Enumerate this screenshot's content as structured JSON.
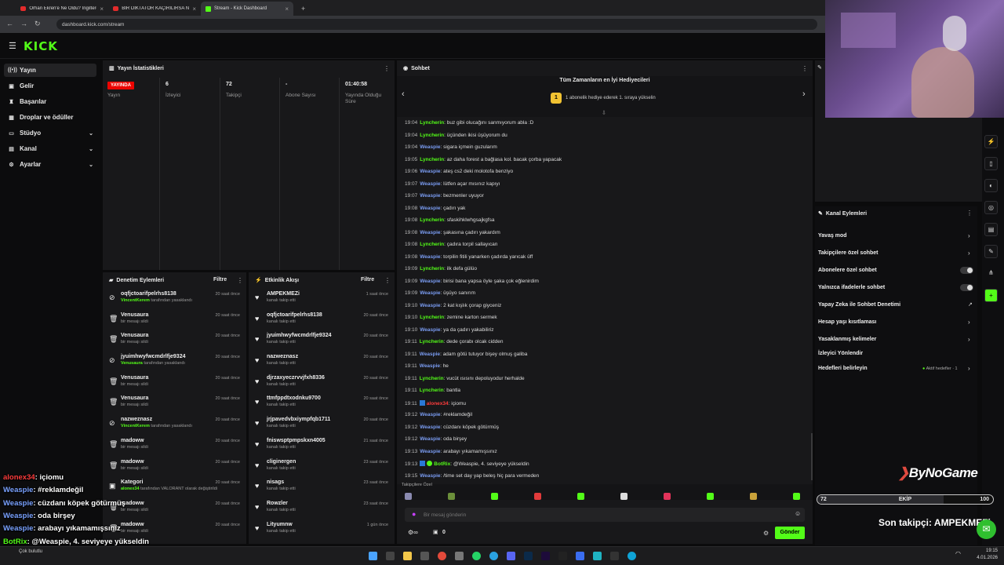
{
  "browser": {
    "tabs": [
      {
        "label": "Orhan Ekren'e Ne Oldu? İngiltere...",
        "icon": "youtube-icon"
      },
      {
        "label": "BİR DİKTATÖR KAÇIRILIRSA NE...",
        "icon": "youtube-icon"
      },
      {
        "label": "Stream - Kick Dashboard",
        "icon": "kick-icon"
      }
    ],
    "url": "dashboard.kick.com/stream"
  },
  "brand": {
    "logo": "KICK",
    "accent": "#53fc18"
  },
  "sidebar": {
    "items": [
      {
        "label": "Yayın",
        "icon": "broadcast-icon"
      },
      {
        "label": "Gelir",
        "icon": "income-icon"
      },
      {
        "label": "Başarılar",
        "icon": "trophy-icon"
      },
      {
        "label": "Droplar ve ödüller",
        "icon": "gift-icon"
      },
      {
        "label": "Stüdyo",
        "icon": "studio-icon"
      },
      {
        "label": "Kanal",
        "icon": "channel-icon"
      },
      {
        "label": "Ayarlar",
        "icon": "gear-icon"
      }
    ]
  },
  "stats": {
    "title": "Yayın İstatistikleri",
    "live_badge": "YAYINDA",
    "items": [
      {
        "value": "",
        "label": "Yayın"
      },
      {
        "value": "6",
        "label": "İzleyici"
      },
      {
        "value": "72",
        "label": "Takipçi"
      },
      {
        "value": "-",
        "label": "Abone Sayısı"
      },
      {
        "value": "01:40:58",
        "label": "Yayında Olduğu Süre"
      }
    ]
  },
  "moderation": {
    "title": "Denetim Eylemleri",
    "filter": "Filtre",
    "rows": [
      {
        "icon": "ban-icon",
        "name": "oqfjctoarifpelrhs8138",
        "actor": "VincentKerem",
        "detail": "tarafından yasaklandı",
        "time": "20 saat önce"
      },
      {
        "icon": "trash-icon",
        "name": "Venusaura",
        "actor": "",
        "detail": "bir mesajı sildi",
        "time": "20 saat önce"
      },
      {
        "icon": "trash-icon",
        "name": "Venusaura",
        "actor": "",
        "detail": "bir mesajı sildi",
        "time": "20 saat önce"
      },
      {
        "icon": "ban-icon",
        "name": "jyuimhwyfwcmdrlfje9324",
        "actor": "Venusaura",
        "detail": "tarafından yasaklandı",
        "time": "20 saat önce"
      },
      {
        "icon": "trash-icon",
        "name": "Venusaura",
        "actor": "",
        "detail": "bir mesajı sildi",
        "time": "20 saat önce"
      },
      {
        "icon": "trash-icon",
        "name": "Venusaura",
        "actor": "",
        "detail": "bir mesajı sildi",
        "time": "20 saat önce"
      },
      {
        "icon": "ban-icon",
        "name": "nazweznasz",
        "actor": "VincentKerem",
        "detail": "tarafından yasaklandı",
        "time": "20 saat önce"
      },
      {
        "icon": "trash-icon",
        "name": "madoww",
        "actor": "",
        "detail": "bir mesajı sildi",
        "time": "20 saat önce"
      },
      {
        "icon": "trash-icon",
        "name": "madoww",
        "actor": "",
        "detail": "bir mesajı sildi",
        "time": "20 saat önce"
      },
      {
        "icon": "category-icon",
        "name": "Kategori",
        "actor": "alonex34",
        "detail": "tarafından VALORANT olarak değiştirildi",
        "time": "20 saat önce"
      },
      {
        "icon": "trash-icon",
        "name": "madoww",
        "actor": "",
        "detail": "bir mesajı sildi",
        "time": "20 saat önce"
      },
      {
        "icon": "trash-icon",
        "name": "madoww",
        "actor": "",
        "detail": "bir mesajı sildi",
        "time": "20 saat önce"
      }
    ]
  },
  "activity": {
    "title": "Etkinlik Akışı",
    "filter": "Filtre",
    "rows": [
      {
        "name": "AMPEKMEZi",
        "detail": "kanalı takip etti",
        "time": "1 saat önce"
      },
      {
        "name": "oqfjctoarifpelrhs8138",
        "detail": "kanalı takip etti",
        "time": "20 saat önce"
      },
      {
        "name": "jyuimhwyfwcmdrlfje9324",
        "detail": "kanalı takip etti",
        "time": "20 saat önce"
      },
      {
        "name": "nazweznasz",
        "detail": "kanalı takip etti",
        "time": "20 saat önce"
      },
      {
        "name": "djrzaxyeczrvvjfxh8336",
        "detail": "kanalı takip etti",
        "time": "20 saat önce"
      },
      {
        "name": "ttmfppdtxodnku9700",
        "detail": "kanalı takip etti",
        "time": "20 saat önce"
      },
      {
        "name": "jrjpavedvbxiympfqb1711",
        "detail": "kanalı takip etti",
        "time": "20 saat önce"
      },
      {
        "name": "fniswsptpmpskxn4005",
        "detail": "kanalı takip etti",
        "time": "21 saat önce"
      },
      {
        "name": "cliginergen",
        "detail": "kanalı takip etti",
        "time": "23 saat önce"
      },
      {
        "name": "nisags",
        "detail": "kanalı takip etti",
        "time": "23 saat önce"
      },
      {
        "name": "Rowzler",
        "detail": "kanalı takip etti",
        "time": "23 saat önce"
      },
      {
        "name": "Lityumnw",
        "detail": "kanalı takip etti",
        "time": "1 gün önce"
      }
    ]
  },
  "chat": {
    "title": "Sohbet",
    "gifters_title": "Tüm Zamanların en İyi Hediyecileri",
    "gifters_rank": "1",
    "gifters_hint": "1 abonelik hediye ederek 1. sıraya yükselin",
    "messages": [
      {
        "time": "19:04",
        "user": "Lyncherin",
        "color": "green",
        "text": "buz gibi olucağını sanmıyorum abla :D"
      },
      {
        "time": "19:04",
        "user": "Lyncherin",
        "color": "green",
        "text": "üçünden ikisi üşüyorum du"
      },
      {
        "time": "19:04",
        "user": "Weaspie",
        "color": "blue",
        "text": "sigara içmein guzularım"
      },
      {
        "time": "19:05",
        "user": "Lyncherin",
        "color": "green",
        "text": "az daha forest a bağlasa kol. bacak çorba yapacak"
      },
      {
        "time": "19:06",
        "user": "Weaspie",
        "color": "blue",
        "text": "ateş cs2 deki molotofa benziyo"
      },
      {
        "time": "19:07",
        "user": "Weaspie",
        "color": "blue",
        "text": "lütfen açar mısınız kapıyı"
      },
      {
        "time": "19:07",
        "user": "Weaspie",
        "color": "blue",
        "text": "bezmenler uyuyor"
      },
      {
        "time": "19:08",
        "user": "Weaspie",
        "color": "blue",
        "text": "çadırı yak"
      },
      {
        "time": "19:08",
        "user": "Lyncherin",
        "color": "green",
        "text": "sfaskihklwhgsajkgfsa"
      },
      {
        "time": "19:08",
        "user": "Weaspie",
        "color": "blue",
        "text": "şakasına çadırı yakardım"
      },
      {
        "time": "19:08",
        "user": "Lyncherin",
        "color": "green",
        "text": "çadıra torpil sallayıcan"
      },
      {
        "time": "19:08",
        "user": "Weaspie",
        "color": "blue",
        "text": "torpilin fitili yanarken çadırda yarıcak üff"
      },
      {
        "time": "19:09",
        "user": "Lyncherin",
        "color": "green",
        "text": "ilk defa gülüo"
      },
      {
        "time": "19:09",
        "user": "Weaspie",
        "color": "blue",
        "text": "birisi bana yapsa öyle şaka çok eğlenirdim"
      },
      {
        "time": "19:09",
        "user": "Weaspie",
        "color": "blue",
        "text": "üşüyo sanırım"
      },
      {
        "time": "19:10",
        "user": "Weaspie",
        "color": "blue",
        "text": "2 kat kışlık çorap giyceniz"
      },
      {
        "time": "19:10",
        "user": "Lyncherin",
        "color": "green",
        "text": "zemine karton sermek"
      },
      {
        "time": "19:10",
        "user": "Weaspie",
        "color": "blue",
        "text": "ya da çadırı yakabiliriz"
      },
      {
        "time": "19:11",
        "user": "Lyncherin",
        "color": "green",
        "text": "dede çorabı olcak cidden"
      },
      {
        "time": "19:11",
        "user": "Weaspie",
        "color": "blue",
        "text": "adam götü tutuyor bişey olmuş galiba"
      },
      {
        "time": "19:11",
        "user": "Weaspie",
        "color": "blue",
        "text": "he"
      },
      {
        "time": "19:11",
        "user": "Lyncherin",
        "color": "green",
        "text": "vucüt ısısını depoluyodur herhalde"
      },
      {
        "time": "19:11",
        "user": "Lyncherin",
        "color": "green",
        "text": "bantla"
      },
      {
        "time": "19:11",
        "user": "alonex34",
        "color": "red",
        "text": "içiomu"
      },
      {
        "time": "19:12",
        "user": "Weaspie",
        "color": "blue",
        "text": "#reklamdeğil"
      },
      {
        "time": "19:12",
        "user": "Weaspie",
        "color": "blue",
        "text": "cüzdanı köpek götürmüş"
      },
      {
        "time": "19:12",
        "user": "Weaspie",
        "color": "blue",
        "text": "oda birşey"
      },
      {
        "time": "19:13",
        "user": "Weaspie",
        "color": "blue",
        "text": "arabayı yıkamamışsınız"
      },
      {
        "time": "19:13",
        "user": "BotRix",
        "color": "green",
        "text": "@Weaspie, 4. seviyeye yükseldin"
      },
      {
        "time": "19:15",
        "user": "Weaspie",
        "color": "blue",
        "text": "/time set day yap beleş hiç para vermeden"
      }
    ],
    "followers_only_label": "Takipçilere Özel",
    "input_placeholder": "Bir mesaj gönderin",
    "points": "0",
    "send_label": "Gönder"
  },
  "channel_actions": {
    "title": "Kanal Eylemleri",
    "items": [
      {
        "label": "Yavaş mod",
        "control": "arrow"
      },
      {
        "label": "Takipçilere özel sohbet",
        "control": "arrow"
      },
      {
        "label": "Abonelere özel sohbet",
        "control": "toggle"
      },
      {
        "label": "Yalnızca ifadelerle sohbet",
        "control": "toggle"
      },
      {
        "label": "Yapay Zeka ile Sohbet Denetimi",
        "control": "external"
      },
      {
        "label": "Hesap yaşı kısıtlaması",
        "control": "arrow"
      },
      {
        "label": "Yasaklanmış kelimeler",
        "control": "arrow"
      },
      {
        "label": "İzleyici Yönlendir",
        "control": "none"
      },
      {
        "label": "Hedefleri belirleyin",
        "control": "arrow",
        "extra": "Aktif hedefler · 1"
      }
    ]
  },
  "overlay": {
    "brand": "ByNoGame",
    "goal_current": "72",
    "goal_label": "EKİP",
    "goal_target": "100",
    "goal_progress": 0.72,
    "last_follower": "Son takipçi: AMPEKMEZi",
    "chat": [
      {
        "user": "alonex34",
        "color": "red",
        "text": ": içiomu"
      },
      {
        "user": "Weaspie",
        "color": "blue",
        "text": ": #reklamdeğil"
      },
      {
        "user": "Weaspie",
        "color": "blue",
        "text": ": cüzdanı köpek götürmüş"
      },
      {
        "user": "Weaspie",
        "color": "blue",
        "text": ": oda birşey"
      },
      {
        "user": "Weaspie",
        "color": "blue",
        "text": ": arabayı yıkamamışsınız"
      },
      {
        "user": "BotRix",
        "color": "green",
        "text": ": @Weaspie, 4. seviyeye yükseldin"
      },
      {
        "user": "Weaspie",
        "color": "blue",
        "text": ": /time set day yap beleş hiç para vermeden"
      }
    ]
  },
  "taskbar": {
    "weather": "Çok bulutlu",
    "time": "19:15",
    "date": "4.01.2026"
  }
}
